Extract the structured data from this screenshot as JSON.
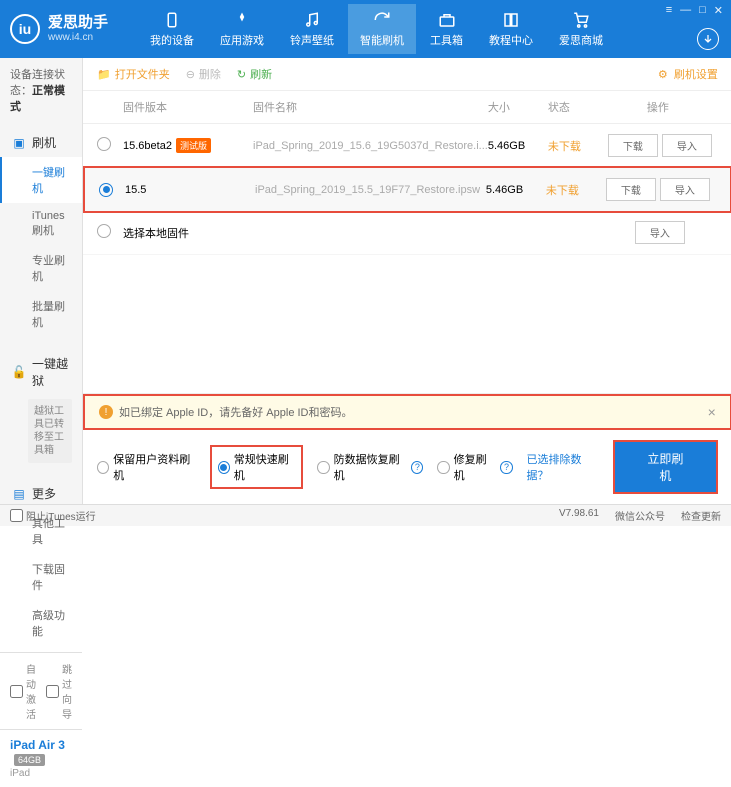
{
  "brand": "爱思助手",
  "url": "www.i4.cn",
  "nav": [
    "我的设备",
    "应用游戏",
    "铃声壁纸",
    "智能刷机",
    "工具箱",
    "教程中心",
    "爱思商城"
  ],
  "winctrls": [
    "≡",
    "—",
    "□",
    "✕"
  ],
  "conn_status_label": "设备连接状态：",
  "conn_status_value": "正常模式",
  "side": {
    "flash": "刷机",
    "items": [
      "一键刷机",
      "iTunes刷机",
      "专业刷机",
      "批量刷机"
    ],
    "jailbreak": "一键越狱",
    "jb_note": "越狱工具已转移至工具箱",
    "more": "更多",
    "more_items": [
      "其他工具",
      "下载固件",
      "高级功能"
    ]
  },
  "side_opts": [
    "自动激活",
    "跳过向导"
  ],
  "device": {
    "name": "iPad Air 3",
    "storage": "64GB",
    "model": "iPad"
  },
  "toolbar": {
    "open": "打开文件夹",
    "delete": "删除",
    "refresh": "刷新",
    "settings": "刷机设置"
  },
  "thead": {
    "ver": "固件版本",
    "name": "固件名称",
    "size": "大小",
    "status": "状态",
    "ops": "操作"
  },
  "rows": [
    {
      "ver": "15.6beta2",
      "beta": "测试版",
      "name": "iPad_Spring_2019_15.6_19G5037d_Restore.i...",
      "size": "5.46GB",
      "status": "未下载",
      "dl": "下载",
      "imp": "导入",
      "selected": false
    },
    {
      "ver": "15.5",
      "beta": "",
      "name": "iPad_Spring_2019_15.5_19F77_Restore.ipsw",
      "size": "5.46GB",
      "status": "未下载",
      "dl": "下载",
      "imp": "导入",
      "selected": true
    }
  ],
  "local_fw": "选择本地固件",
  "local_imp": "导入",
  "warn": "如已绑定 Apple ID，请先备好 Apple ID和密码。",
  "opts": [
    "保留用户资料刷机",
    "常规快速刷机",
    "防数据恢复刷机",
    "修复刷机"
  ],
  "exclude_link": "已选排除数据？",
  "flash_btn": "立即刷机",
  "status": {
    "itunes": "阻止iTunes运行",
    "ver": "V7.98.61",
    "wechat": "微信公众号",
    "update": "检查更新"
  }
}
